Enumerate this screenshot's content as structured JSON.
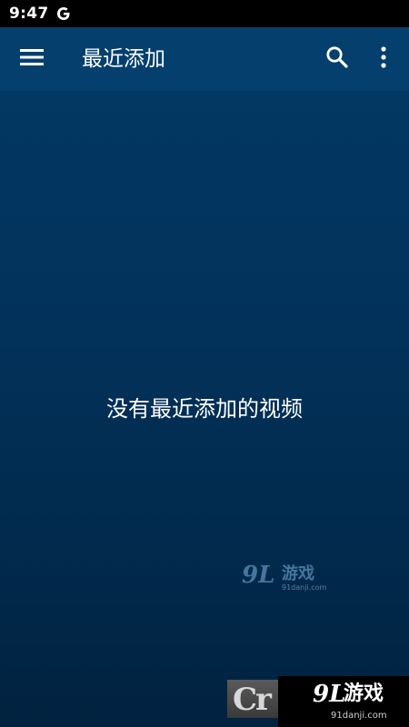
{
  "status_bar": {
    "time": "9:47",
    "notification_icon": "google-g-icon"
  },
  "app_bar": {
    "title": "最近添加",
    "menu_icon": "hamburger-menu-icon",
    "search_icon": "search-icon",
    "more_icon": "more-vert-icon"
  },
  "main": {
    "empty_message": "没有最近添加的视频"
  },
  "watermarks": {
    "center": {
      "number": "9L",
      "name": "游戏",
      "url": "91danji.com"
    },
    "bottom_left": {
      "text": "Cr"
    },
    "bottom_right": {
      "number": "9L",
      "name": "游戏",
      "url": "91danji.com"
    }
  },
  "colors": {
    "background_top": "#023a66",
    "background_bottom": "#01223f",
    "app_bar": "#053f6e",
    "status_bar": "#000000"
  }
}
